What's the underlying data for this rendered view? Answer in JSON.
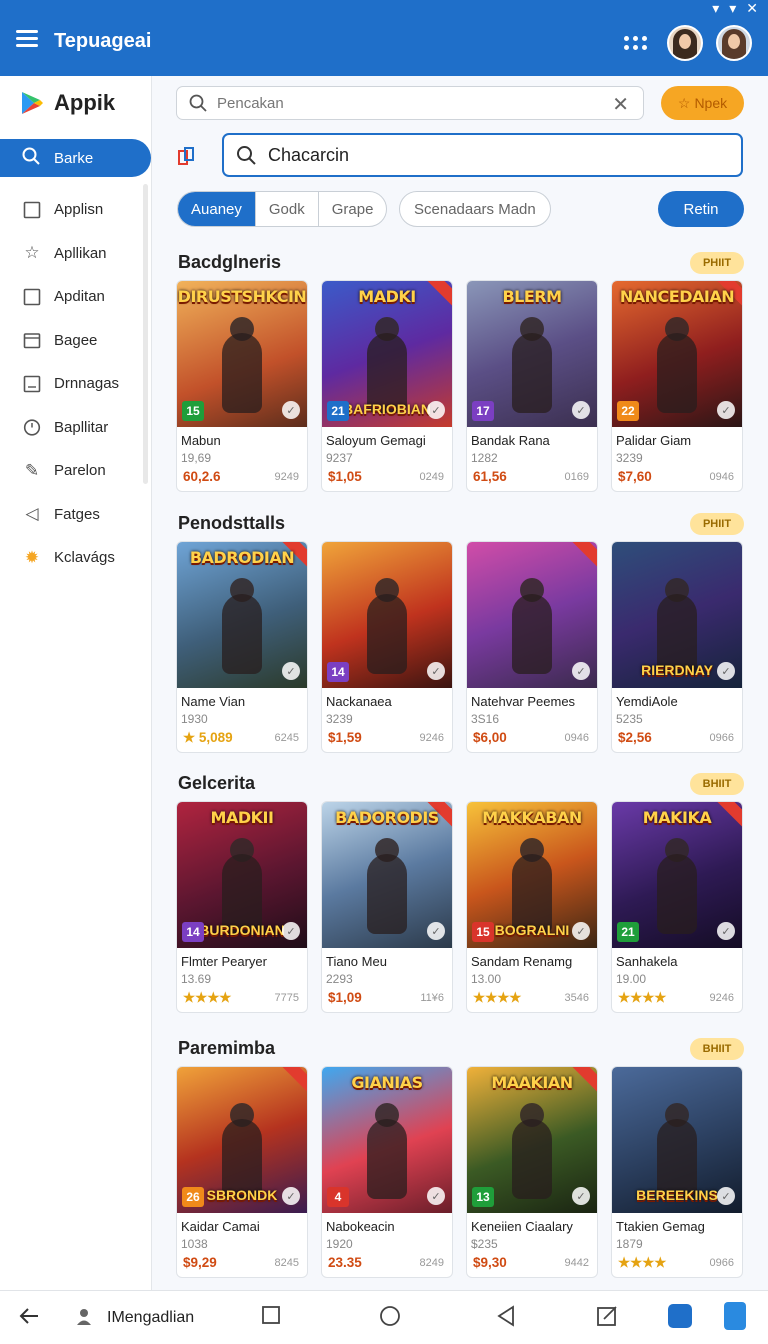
{
  "appbar": {
    "title": "Tepuageai"
  },
  "sidebar": {
    "logo": "Appik",
    "active_item": "Barke",
    "items": [
      {
        "label": "Applisn",
        "icon": "square-icon"
      },
      {
        "label": "Apllikan",
        "icon": "star-outline-icon"
      },
      {
        "label": "Apditan",
        "icon": "square-icon"
      },
      {
        "label": "Bagee",
        "icon": "calendar-icon"
      },
      {
        "label": "Drnnagas",
        "icon": "frame-icon"
      },
      {
        "label": "Bapllitar",
        "icon": "clock-icon"
      },
      {
        "label": "Parelon",
        "icon": "pencil-icon"
      },
      {
        "label": "Fatges",
        "icon": "megaphone-icon"
      },
      {
        "label": "Kclavágs",
        "icon": "sun-icon"
      }
    ]
  },
  "search": {
    "primary_placeholder": "Pencakan",
    "action_label": "Npek",
    "secondary_value": "Chacarcin"
  },
  "filters": {
    "segments": [
      "Auaney",
      "Godk",
      "Grape"
    ],
    "chip": "Scenadaars Madn",
    "button": "Retin"
  },
  "sections": [
    {
      "title": "Bacdglneris",
      "badge": "PHIIT",
      "cards": [
        {
          "art_title": "DIRUSTSHKCIN",
          "art_subtitle": "",
          "age": "15",
          "name": "Mabun",
          "sub": "19,69",
          "price": "60,2.6",
          "meta": "9249"
        },
        {
          "art_title": "MADKI",
          "art_subtitle": "BAFRIOBIAN",
          "age": "21",
          "name": "Saloyum Gemagi",
          "sub": "9237",
          "price": "$1,05",
          "meta": "0249"
        },
        {
          "art_title": "BLERM",
          "art_subtitle": "",
          "age": "17",
          "name": "Bandak Rana",
          "sub": "1282",
          "price": "61,56",
          "meta": "0169"
        },
        {
          "art_title": "NANCEDAIAN",
          "art_subtitle": "",
          "age": "22",
          "name": "Palidar Giam",
          "sub": "3239",
          "price": "$7,60",
          "meta": "0946"
        }
      ]
    },
    {
      "title": "Penodsttalls",
      "badge": "PHIIT",
      "cards": [
        {
          "art_title": "BADRODIAN",
          "art_subtitle": "",
          "age": "",
          "name": "Name Vian",
          "sub": "1930",
          "price": "★ 5,089",
          "meta": "6245"
        },
        {
          "art_title": "",
          "art_subtitle": "",
          "age": "14",
          "name": "Nackanaea",
          "sub": "3239",
          "price": "$1,59",
          "meta": "9246"
        },
        {
          "art_title": "",
          "art_subtitle": "",
          "age": "",
          "name": "Natehvar Peemes",
          "sub": "3S16",
          "price": "$6,00",
          "meta": "0946"
        },
        {
          "art_title": "",
          "art_subtitle": "RIERDNAY",
          "age": "",
          "name": "YemdiAole",
          "sub": "5235",
          "price": "$2,56",
          "meta": "0966"
        }
      ]
    },
    {
      "title": "Gelcerita",
      "badge": "BHIIT",
      "cards": [
        {
          "art_title": "MADKII",
          "art_subtitle": "BURDONIAN",
          "age": "14",
          "name": "Flmter Pearyer",
          "sub": "13.69",
          "price": "★★★★",
          "meta": "7775"
        },
        {
          "art_title": "BADORODIS",
          "art_subtitle": "",
          "age": "",
          "name": "Tiano Meu",
          "sub": "2293",
          "price": "$1,09",
          "meta": "11¥6"
        },
        {
          "art_title": "MAKKABAN",
          "art_subtitle": "BOGRALNI",
          "age": "15",
          "name": "Sandam Renamg",
          "sub": "13.00",
          "price": "★★★★",
          "meta": "3546"
        },
        {
          "art_title": "MAKIKA",
          "art_subtitle": "",
          "age": "21",
          "name": "Sanhakela",
          "sub": "19.00",
          "price": "★★★★",
          "meta": "9246"
        }
      ]
    },
    {
      "title": "Paremimba",
      "badge": "BHIIT",
      "cards": [
        {
          "art_title": "",
          "art_subtitle": "SBRONDK",
          "age": "26",
          "name": "Kaidar Camai",
          "sub": "1038",
          "price": "$9,29",
          "meta": "8245"
        },
        {
          "art_title": "GIANIAS",
          "art_subtitle": "",
          "age": "4",
          "name": "Nabokeacin",
          "sub": "1920",
          "price": "23.35",
          "meta": "8249"
        },
        {
          "art_title": "MAAKIAN",
          "art_subtitle": "",
          "age": "13",
          "name": "Keneiien Ciaalary",
          "sub": "$235",
          "price": "$9,30",
          "meta": "9442"
        },
        {
          "art_title": "",
          "art_subtitle": "BEREEKINS",
          "age": "",
          "name": "Ttakien Gemag",
          "sub": "1879",
          "price": "★★★★",
          "meta": "0966"
        }
      ]
    }
  ],
  "bottombar": {
    "label": "IMengadlian"
  },
  "colors": {
    "primary": "#1f6fc9",
    "accent": "#f6a623",
    "price": "#d04b13"
  }
}
